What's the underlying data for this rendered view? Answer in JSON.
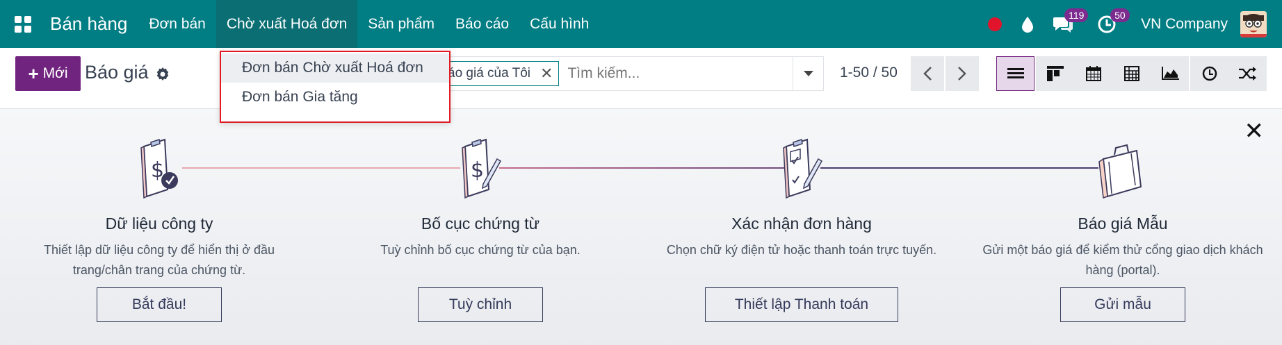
{
  "navbar": {
    "app_name": "Bán hàng",
    "menu": [
      {
        "label": "Đơn bán"
      },
      {
        "label": "Chờ xuất Hoá đơn"
      },
      {
        "label": "Sản phẩm"
      },
      {
        "label": "Báo cáo"
      },
      {
        "label": "Cấu hình"
      }
    ],
    "messages_count": "119",
    "activities_count": "50",
    "company": "VN Company",
    "accent_color": "#017e84"
  },
  "dropdown": {
    "items": [
      {
        "label": "Đơn bán Chờ xuất Hoá đơn"
      },
      {
        "label": "Đơn bán Gia tăng"
      }
    ]
  },
  "controlbar": {
    "new_label": "Mới",
    "title": "Báo giá",
    "facet_label": "áo giá của Tôi",
    "search_placeholder": "Tìm kiếm...",
    "pager": "1-50 / 50",
    "brand_color": "#71247f"
  },
  "onboarding": {
    "steps": [
      {
        "title": "Dữ liệu công ty",
        "desc": "Thiết lập dữ liệu công ty để hiển thị ở đầu trang/chân trang của chứng từ.",
        "button": "Bắt đầu!"
      },
      {
        "title": "Bố cục chứng từ",
        "desc": "Tuỳ chỉnh bố cục chứng từ của bạn.",
        "button": "Tuỳ chỉnh"
      },
      {
        "title": "Xác nhận đơn hàng",
        "desc": "Chọn chữ ký điện tử hoặc thanh toán trực tuyến.",
        "button": "Thiết lập Thanh toán"
      },
      {
        "title": "Báo giá Mẫu",
        "desc": "Gửi một báo giá để kiểm thử cổng giao dịch khách hàng (portal).",
        "button": "Gửi mẫu"
      }
    ]
  }
}
